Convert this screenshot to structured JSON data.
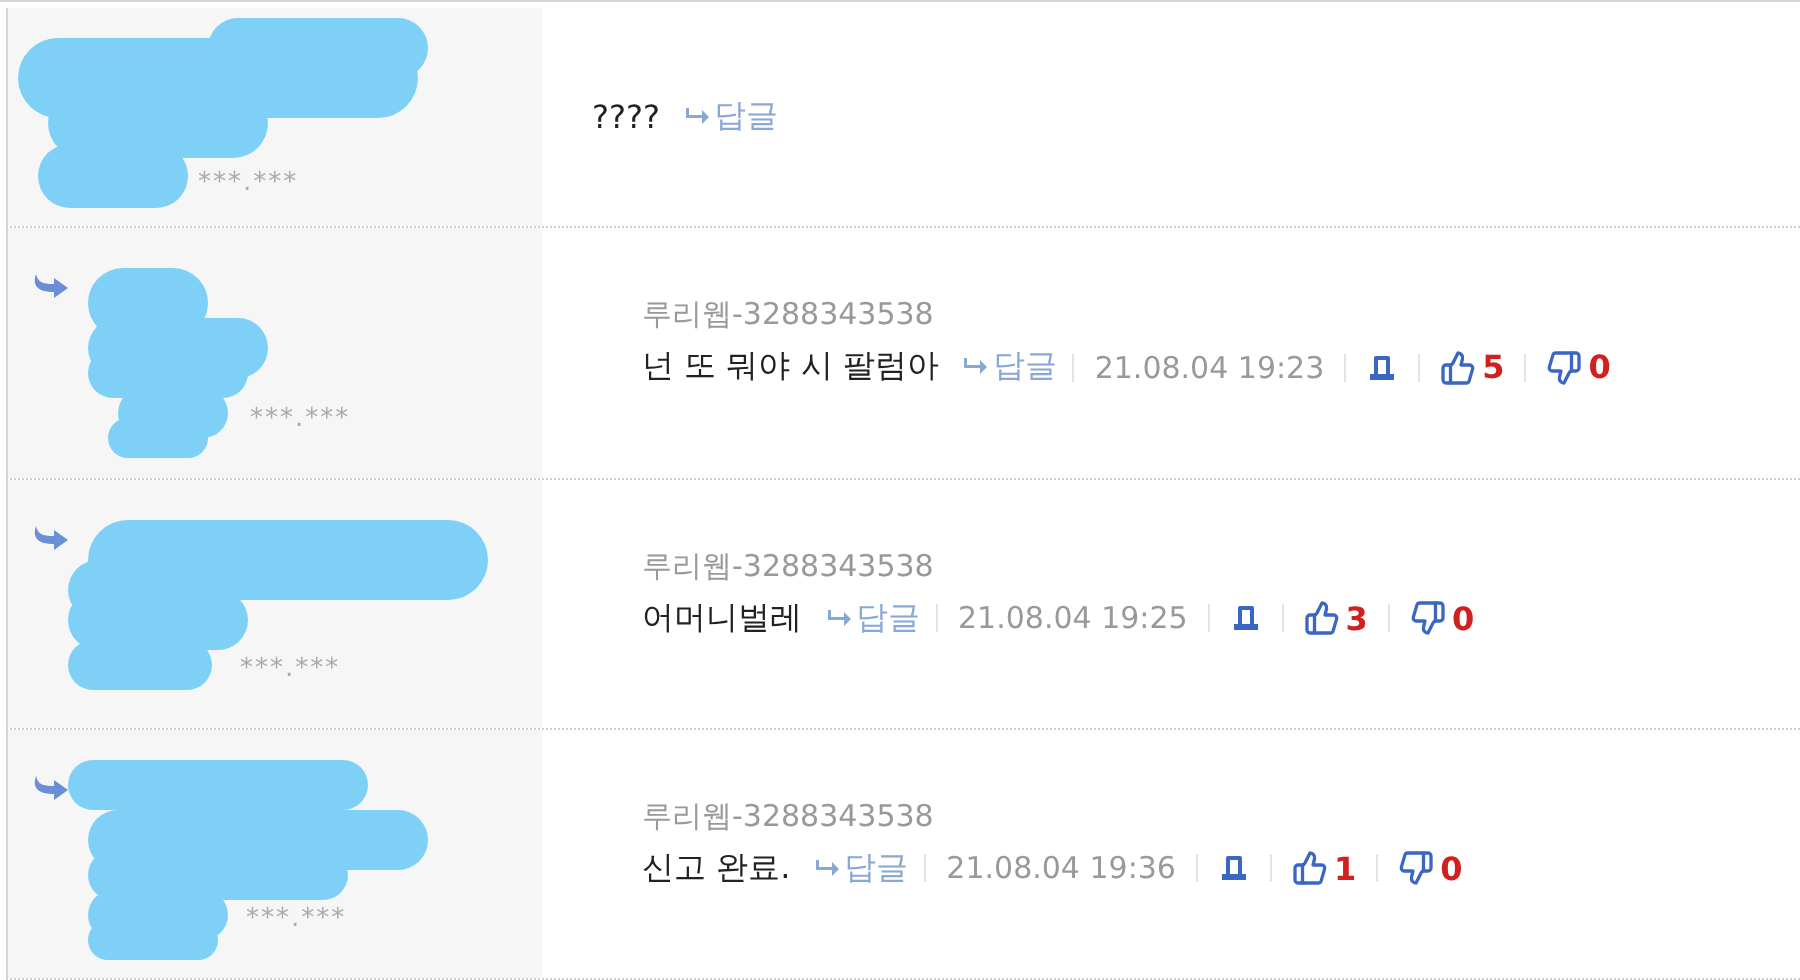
{
  "comments": [
    {
      "kind": "root",
      "ip": "***.***",
      "text": "????",
      "reply_link": "답글"
    },
    {
      "kind": "reply",
      "ip": "***.***",
      "nick": "루리웹-3288343538",
      "text": "넌 또 뭐야 시 팔럼아",
      "reply_link": "답글",
      "date": "21.08.04 19:23",
      "likes": "5",
      "dislikes": "0"
    },
    {
      "kind": "reply",
      "ip": "***.***",
      "nick": "루리웹-3288343538",
      "text": "어머니벌레",
      "reply_link": "답글",
      "date": "21.08.04 19:25",
      "likes": "3",
      "dislikes": "0"
    },
    {
      "kind": "reply",
      "ip": "***.***",
      "nick": "루리웹-3288343538",
      "text": "신고 완료.",
      "reply_link": "답글",
      "date": "21.08.04 19:36",
      "likes": "1",
      "dislikes": "0"
    }
  ]
}
